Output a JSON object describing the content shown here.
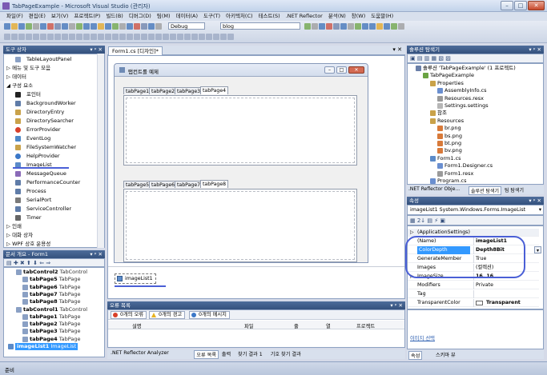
{
  "window": {
    "title": "TabPageExample - Microsoft Visual Studio (관리자)",
    "btn_min": "–",
    "btn_max": "□",
    "btn_close": "✕"
  },
  "menu": [
    "파일(F)",
    "편집(E)",
    "보기(V)",
    "프로젝트(P)",
    "빌드(B)",
    "디버그(D)",
    "팀(M)",
    "데이터(A)",
    "도구(T)",
    "아키텍처(C)",
    "테스트(S)",
    ".NET Reflector",
    "분석(N)",
    "창(W)",
    "도움말(H)"
  ],
  "toolbar": {
    "debug_combo": "Debug",
    "search_combo": "blog"
  },
  "toolbox": {
    "title": "도구 상자",
    "pin": "▾ ᵖ ✕",
    "items": [
      {
        "label": "TableLayoutPanel",
        "indent": 1,
        "icon": "layout"
      },
      {
        "label": "▷ 메뉴 및 도구 모음",
        "indent": 0,
        "icon": ""
      },
      {
        "label": "▷ 데이터",
        "indent": 0,
        "icon": ""
      },
      {
        "label": "◢ 구성 요소",
        "indent": 0,
        "icon": ""
      },
      {
        "label": "포인터",
        "indent": 1,
        "icon": "pointer"
      },
      {
        "label": "BackgroundWorker",
        "indent": 1,
        "icon": "gear"
      },
      {
        "label": "DirectoryEntry",
        "indent": 1,
        "icon": "folder"
      },
      {
        "label": "DirectorySearcher",
        "indent": 1,
        "icon": "folder"
      },
      {
        "label": "ErrorProvider",
        "indent": 1,
        "icon": "error"
      },
      {
        "label": "EventLog",
        "indent": 1,
        "icon": "log"
      },
      {
        "label": "FileSystemWatcher",
        "indent": 1,
        "icon": "folder"
      },
      {
        "label": "HelpProvider",
        "indent": 1,
        "icon": "help"
      },
      {
        "label": "ImageList",
        "indent": 1,
        "icon": "image"
      },
      {
        "label": "MessageQueue",
        "indent": 1,
        "icon": "mail"
      },
      {
        "label": "PerformanceCounter",
        "indent": 1,
        "icon": "gear"
      },
      {
        "label": "Process",
        "indent": 1,
        "icon": "gear"
      },
      {
        "label": "SerialPort",
        "indent": 1,
        "icon": "port"
      },
      {
        "label": "ServiceController",
        "indent": 1,
        "icon": "gear"
      },
      {
        "label": "Timer",
        "indent": 1,
        "icon": "timer"
      },
      {
        "label": "▷ 인쇄",
        "indent": 0,
        "icon": ""
      },
      {
        "label": "▷ 대화 상자",
        "indent": 0,
        "icon": ""
      },
      {
        "label": "▷ WPF 상호 운용성",
        "indent": 0,
        "icon": ""
      }
    ]
  },
  "doc_outline": {
    "title": "문서 개요 - Form1",
    "pin": "▾ ᵖ ✕",
    "items": [
      {
        "name": "tabControl2",
        "type": "TabControl",
        "indent": 1
      },
      {
        "name": "tabPage5",
        "type": "TabPage",
        "indent": 2
      },
      {
        "name": "tabPage6",
        "type": "TabPage",
        "indent": 2
      },
      {
        "name": "tabPage7",
        "type": "TabPage",
        "indent": 2
      },
      {
        "name": "tabPage8",
        "type": "TabPage",
        "indent": 2
      },
      {
        "name": "tabControl1",
        "type": "TabControl",
        "indent": 1
      },
      {
        "name": "tabPage1",
        "type": "TabPage",
        "indent": 2
      },
      {
        "name": "tabPage2",
        "type": "TabPage",
        "indent": 2
      },
      {
        "name": "tabPage3",
        "type": "TabPage",
        "indent": 2
      },
      {
        "name": "tabPage4",
        "type": "TabPage",
        "indent": 2
      },
      {
        "name": "imageList1",
        "type": "ImageList",
        "indent": 0
      }
    ]
  },
  "designer": {
    "tab_label": "Form1.cs [디자인]*",
    "form_title": "탭컨트롤 예제",
    "tabs_top": [
      "tabPage1",
      "tabPage2",
      "tabPage3",
      "tabPage4"
    ],
    "tabs_bottom": [
      "tabPage5",
      "tabPage6",
      "tabPage7",
      "tabPage8"
    ],
    "tray_item": "imageList1"
  },
  "error_list": {
    "title": "오류 목록",
    "errors": "0개의 오류",
    "warnings": "0개의 경고",
    "messages": "0개의 메시지",
    "columns": [
      "설명",
      "파일",
      "줄",
      "열",
      "프로젝트"
    ],
    "bottom_tabs": [
      ".NET Reflector Analyzer",
      "오류 목록",
      "출력",
      "찾기 결과 1",
      "기호 찾기 결과"
    ]
  },
  "solution": {
    "title": "솔루션 탐색기",
    "items": [
      {
        "label": "솔루션 'TabPageExample' (1 프로젝트)",
        "indent": 0
      },
      {
        "label": "TabPageExample",
        "indent": 1
      },
      {
        "label": "Properties",
        "indent": 2
      },
      {
        "label": "AssemblyInfo.cs",
        "indent": 3
      },
      {
        "label": "Resources.resx",
        "indent": 3
      },
      {
        "label": "Settings.settings",
        "indent": 3
      },
      {
        "label": "참조",
        "indent": 2
      },
      {
        "label": "Resources",
        "indent": 2
      },
      {
        "label": "br.png",
        "indent": 3
      },
      {
        "label": "bs.png",
        "indent": 3
      },
      {
        "label": "bt.png",
        "indent": 3
      },
      {
        "label": "bv.png",
        "indent": 3
      },
      {
        "label": "Form1.cs",
        "indent": 2
      },
      {
        "label": "Form1.Designer.cs",
        "indent": 3
      },
      {
        "label": "Form1.resx",
        "indent": 3
      },
      {
        "label": "Program.cs",
        "indent": 2
      }
    ],
    "tabs": [
      ".NET Reflector Obje...",
      "솔루션 탐색기",
      "팀 탐색기"
    ]
  },
  "properties": {
    "title": "속성",
    "object": "imageList1 System.Windows.Forms.ImageList",
    "rows": [
      {
        "k": "(ApplicationSettings)",
        "v": "",
        "bold": false,
        "sel": false,
        "cat": true
      },
      {
        "k": "(Name)",
        "v": "imageList1",
        "bold": true,
        "sel": false,
        "cat": false
      },
      {
        "k": "ColorDepth",
        "v": "Depth8Bit",
        "bold": true,
        "sel": true,
        "cat": false
      },
      {
        "k": "GenerateMember",
        "v": "True",
        "bold": false,
        "sel": false,
        "cat": false
      },
      {
        "k": "Images",
        "v": "(컬렉션)",
        "bold": false,
        "sel": false,
        "cat": false
      },
      {
        "k": "ImageSize",
        "v": "16, 16",
        "bold": true,
        "sel": false,
        "cat": true
      },
      {
        "k": "Modifiers",
        "v": "Private",
        "bold": false,
        "sel": false,
        "cat": false
      },
      {
        "k": "Tag",
        "v": "",
        "bold": false,
        "sel": false,
        "cat": false
      },
      {
        "k": "TransparentColor",
        "v": "Transparent",
        "bold": true,
        "sel": false,
        "cat": false
      }
    ],
    "link": "이미지 선택",
    "tabs": [
      "속성",
      "스키마 뷰"
    ]
  },
  "status": {
    "text": "준비"
  },
  "colors": {
    "accent": "#3a5a8c",
    "selection": "#3399ff",
    "annotation": "#4a5fd6"
  }
}
